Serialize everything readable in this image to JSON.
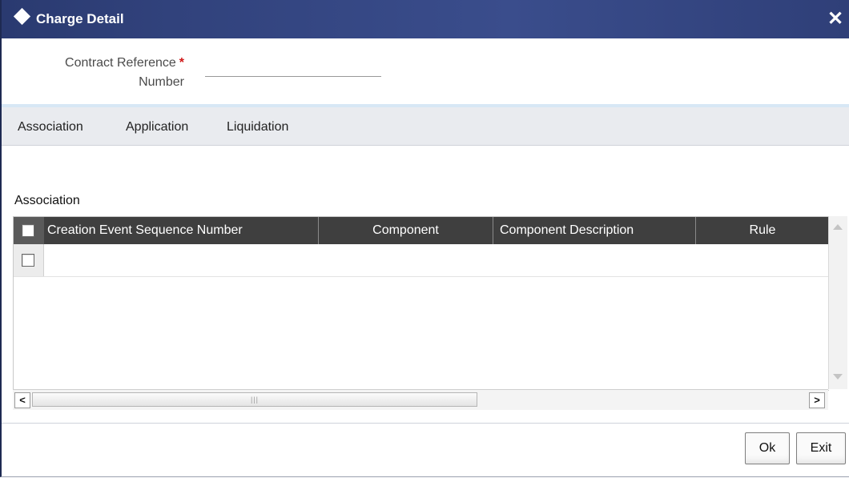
{
  "window": {
    "title": "Charge Detail"
  },
  "form": {
    "contract_ref_label_line1": "Contract Reference",
    "contract_ref_required": "*",
    "contract_ref_label_line2": "Number",
    "contract_ref_value": ""
  },
  "tabs": [
    {
      "label": "Association"
    },
    {
      "label": "Application"
    },
    {
      "label": "Liquidation"
    }
  ],
  "section": {
    "label": "Association"
  },
  "grid": {
    "columns": [
      "Creation Event Sequence Number",
      "Component",
      "Component Description",
      "Rule"
    ],
    "rows": [
      {
        "checked": false
      }
    ]
  },
  "buttons": {
    "ok": "Ok",
    "exit": "Exit"
  },
  "colors": {
    "titlebar": "#31427c",
    "grid_header": "#3f3f3f",
    "required": "#d01818"
  }
}
